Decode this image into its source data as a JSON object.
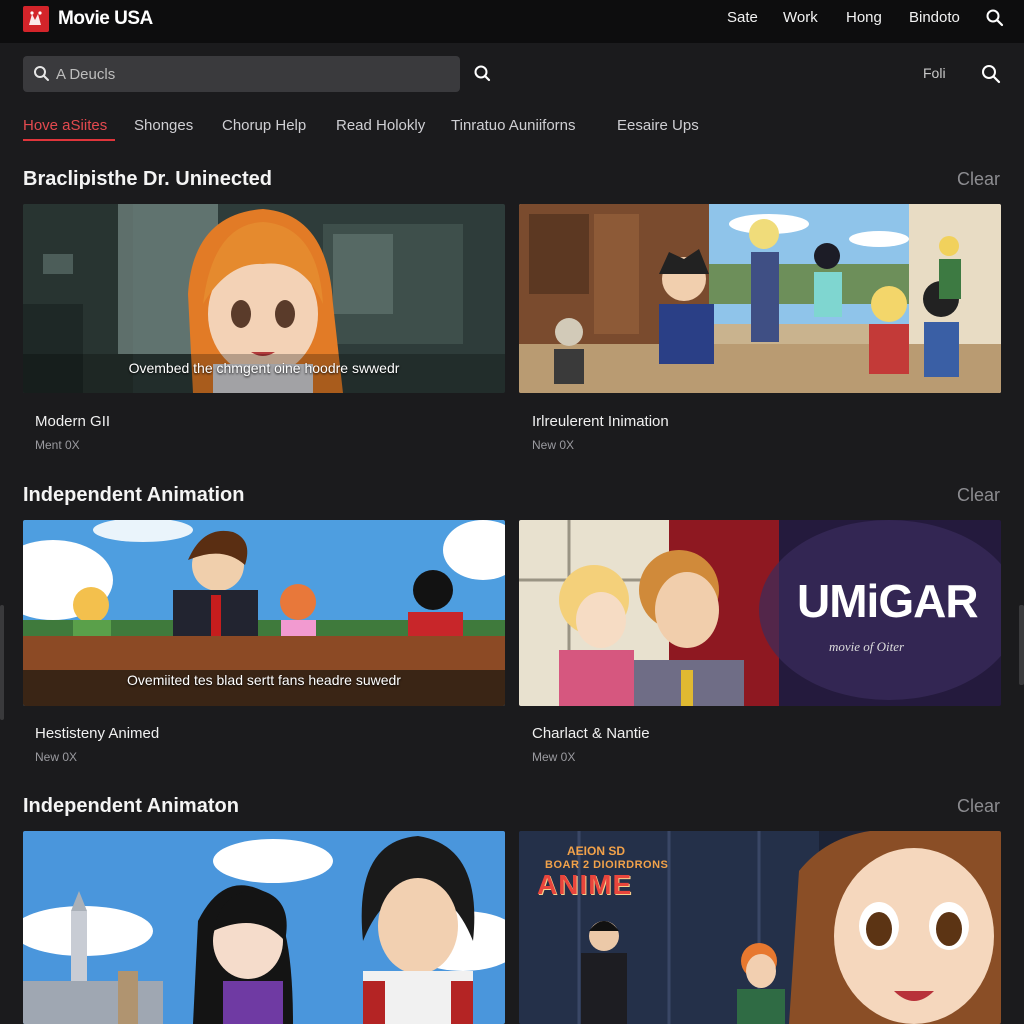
{
  "app": {
    "title": "Movie USA"
  },
  "nav": {
    "items": [
      "Sate",
      "Work",
      "Hong",
      "Bindoto"
    ]
  },
  "search": {
    "placeholder": "A Deucls",
    "fold_label": "Foli"
  },
  "tabs": [
    "Hove aSiites",
    "Shonges",
    "Chorup Help",
    "Read Holokly",
    "Tinratuo Auniiforns",
    "Eesaire Ups"
  ],
  "sections": [
    {
      "title": "Braclipisthe Dr. Uninected",
      "clear": "Clear",
      "cards": [
        {
          "title": "Modern GII",
          "subtitle": "Ment 0X",
          "overlay": "Ovembed the chmgent oine hoodre swwedr"
        },
        {
          "title": "Irlreulerent Inimation",
          "subtitle": "New 0X",
          "overlay": ""
        }
      ]
    },
    {
      "title": "Independent Animation",
      "clear": "Clear",
      "cards": [
        {
          "title": "Hestisteny Animed",
          "subtitle": "New 0X",
          "overlay": "Ovemiited tes blad sertt fans headre suwedr"
        },
        {
          "title": "Charlact & Nantie",
          "subtitle": "Mew 0X",
          "overlay": "",
          "poster_title": "UMiGAR",
          "poster_sub": "movie of Oiter"
        }
      ]
    },
    {
      "title": "Independent Animaton",
      "clear": "Clear",
      "cards": [
        {
          "title": "",
          "subtitle": "",
          "overlay": ""
        },
        {
          "title": "",
          "subtitle": "",
          "overlay": "",
          "poster_small": "AEION SD",
          "poster_mid": "BOAR 2 DIOIRDRONS",
          "poster_big": "ANIME"
        }
      ]
    }
  ],
  "colors": {
    "background": "#1b1b1d",
    "topbar": "#0d0d0e",
    "accent": "#e0353b",
    "muted": "#8c8c90"
  },
  "icons": [
    "logo-icon",
    "search-icon"
  ]
}
